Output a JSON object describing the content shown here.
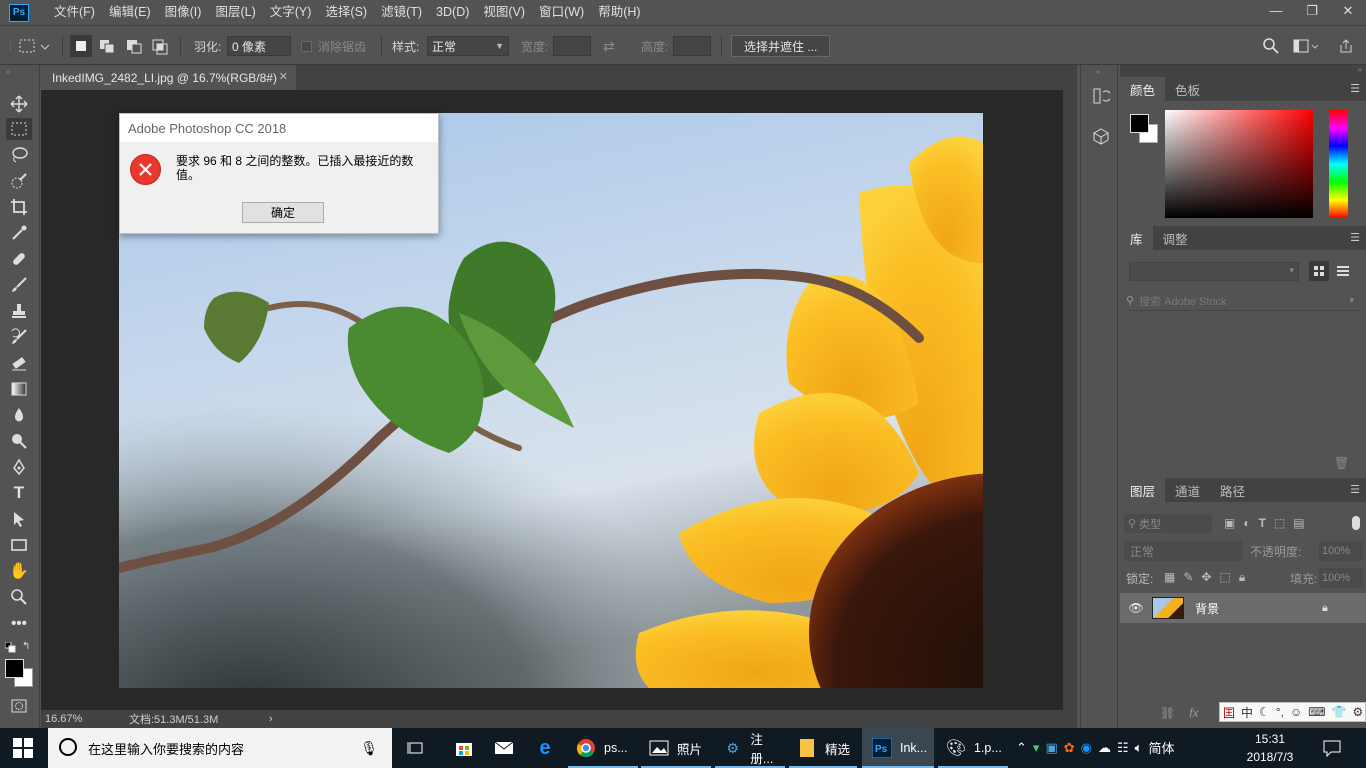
{
  "app": {
    "logo": "Ps"
  },
  "menu": [
    "文件(F)",
    "编辑(E)",
    "图像(I)",
    "图层(L)",
    "文字(Y)",
    "选择(S)",
    "滤镜(T)",
    "3D(D)",
    "视图(V)",
    "窗口(W)",
    "帮助(H)"
  ],
  "window_controls": {
    "minimize": "—",
    "restore": "❐",
    "close": "✕"
  },
  "options": {
    "feather_label": "羽化:",
    "feather_value": "0 像素",
    "antialias_label": "消除锯齿",
    "style_label": "样式:",
    "style_value": "正常",
    "width_label": "宽度:",
    "height_label": "高度:",
    "select_mask_button": "选择并遮住 ..."
  },
  "document": {
    "tab_title": "InkedIMG_2482_LI.jpg @ 16.7%(RGB/8#)",
    "close": "✕",
    "zoom": "16.67%",
    "doc_info": "文档:51.3M/51.3M",
    "status_arrow": "›"
  },
  "dialog": {
    "title": "Adobe Photoshop CC 2018",
    "message": "要求 96 和 8 之间的整数。已插入最接近的数值。",
    "ok_label": "确定",
    "icon": "error-icon"
  },
  "panels": {
    "color_tabs": [
      "颜色",
      "色板"
    ],
    "library_tabs": [
      "库",
      "调整"
    ],
    "library_search_placeholder": "搜索 Adobe Stock",
    "layers_tabs": [
      "图层",
      "通道",
      "路径"
    ],
    "layers_filter": "类型",
    "blend_mode": "正常",
    "opacity_label": "不透明度:",
    "opacity_value": "100%",
    "lock_label": "锁定:",
    "fill_label": "填充:",
    "fill_value": "100%",
    "layer_name": "背景"
  },
  "taskbar": {
    "search_placeholder": "在这里输入你要搜索的内容",
    "apps": [
      {
        "label": "ps...",
        "icon": "chrome-icon"
      },
      {
        "label": "照片",
        "icon": "photos-icon"
      },
      {
        "label": "注册...",
        "icon": "registry-icon"
      },
      {
        "label": "精选",
        "icon": "folder-icon"
      },
      {
        "label": "Ink...",
        "icon": "photoshop-icon"
      },
      {
        "label": "1.p...",
        "icon": "paint-icon"
      }
    ],
    "lang": "简体",
    "time": "15:31",
    "date": "2018/7/3"
  },
  "ime": {
    "mode": "中"
  },
  "colors": {
    "ps_blue": "#31a8ff",
    "error_red": "#e8392c",
    "accent": "#76b9ed"
  }
}
